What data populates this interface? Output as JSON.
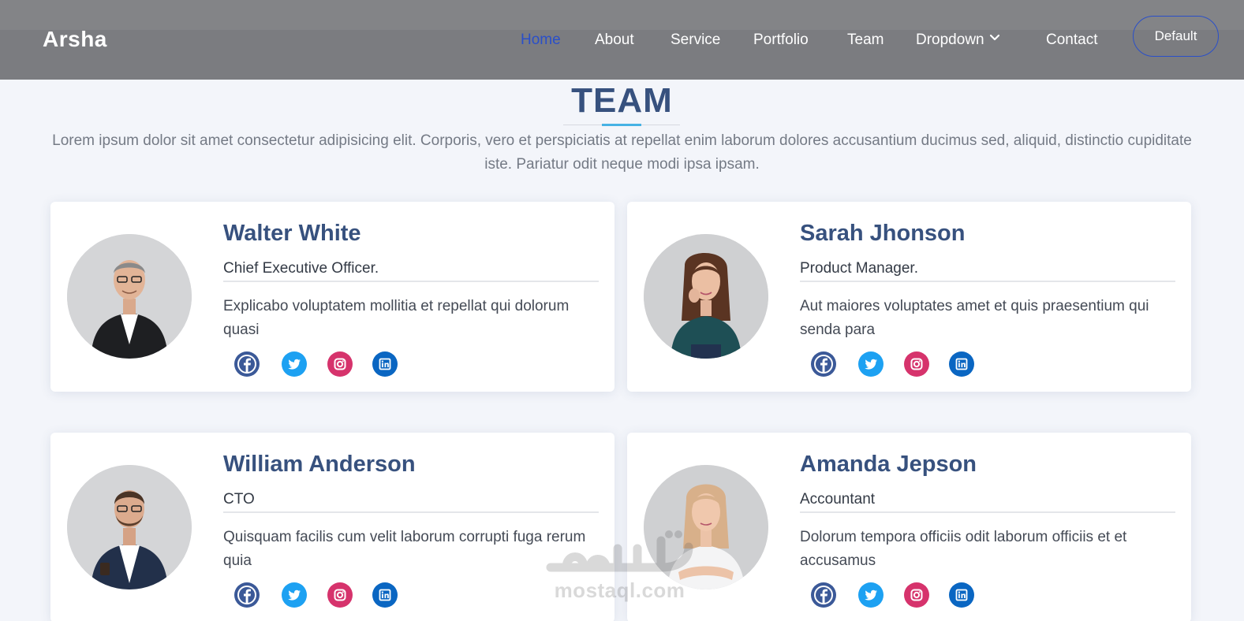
{
  "header": {
    "logo": "Arsha",
    "nav": [
      "Home",
      "About",
      "Service",
      "Portfolio",
      "Team",
      "Dropdown",
      "Contact"
    ],
    "active_item": "Home",
    "cta_label": "Default"
  },
  "section": {
    "title": "TEAM",
    "description": "Lorem ipsum dolor sit amet consectetur adipisicing elit. Corporis, vero et perspiciatis at repellat enim laborum dolores accusantium ducimus sed, aliquid, distinctio cupiditate iste. Pariatur odit neque modi ipsa ipsam."
  },
  "team": [
    {
      "name": "Walter White",
      "role": "Chief Executive Officer.",
      "description": "Explicabo voluptatem mollitia et repellat qui dolorum quasi"
    },
    {
      "name": "Sarah Jhonson",
      "role": "Product Manager.",
      "description": "Aut maiores voluptates amet et quis praesentium qui senda para"
    },
    {
      "name": "William Anderson",
      "role": "CTO",
      "description": "Quisquam facilis cum velit laborum corrupti fuga rerum quia"
    },
    {
      "name": "Amanda Jepson",
      "role": "Accountant",
      "description": "Dolorum tempora officiis odit laborum officiis et et accusamus"
    }
  ],
  "social_icons": [
    "facebook-icon",
    "twitter-icon",
    "instagram-icon",
    "linkedin-icon"
  ],
  "colors": {
    "primary": "#37517e",
    "accent": "#47b2e4",
    "active_nav": "#2a4fc9",
    "facebook": "#3b5998",
    "twitter": "#1da1f2",
    "instagram": "#d6336c",
    "linkedin": "#0a66c2"
  },
  "watermark": {
    "arabic": "مستقل",
    "latin": "mostaql.com"
  }
}
